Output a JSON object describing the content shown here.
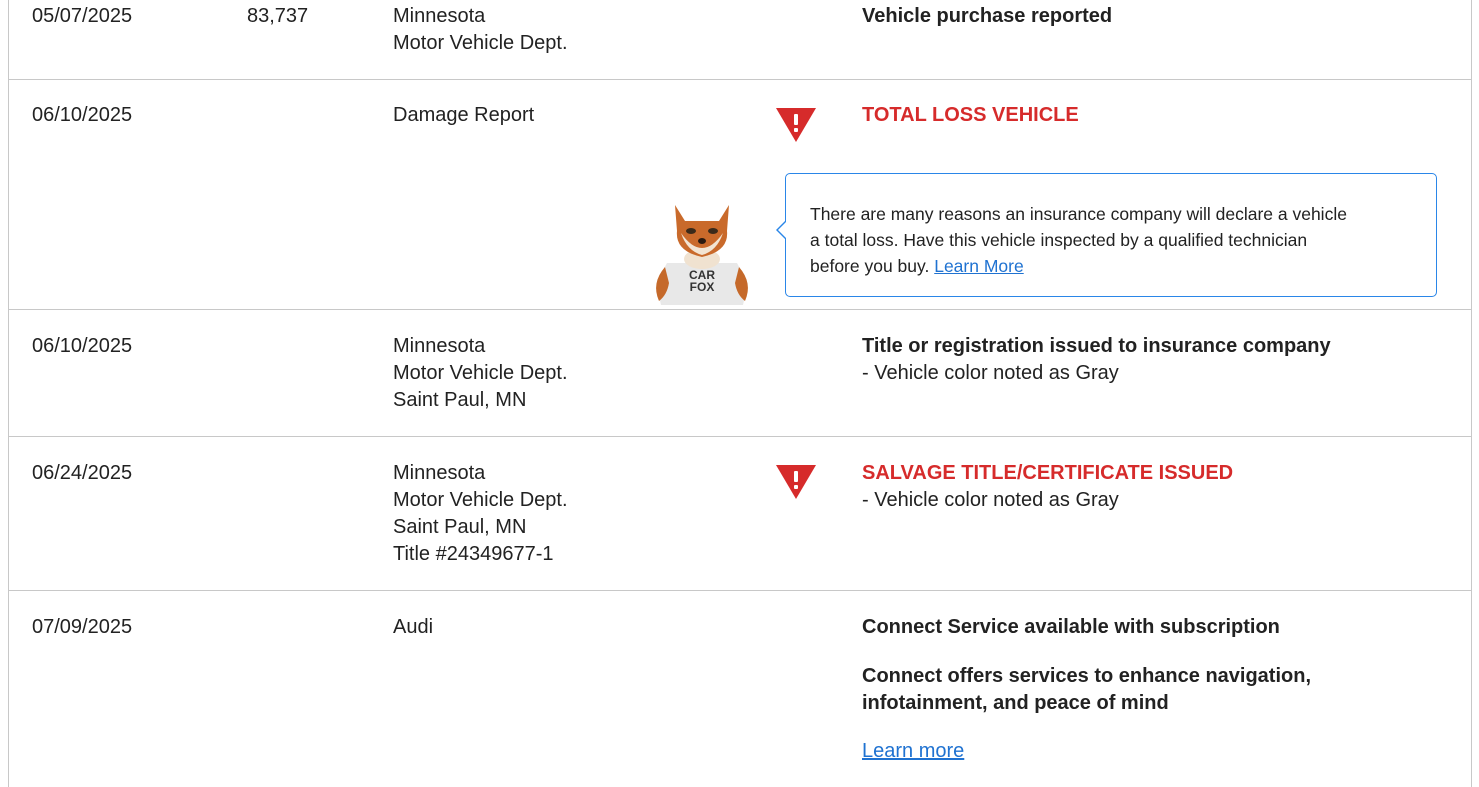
{
  "rows": [
    {
      "date": "05/07/2025",
      "mileage": "83,737",
      "source": [
        "Minnesota",
        "Motor Vehicle Dept."
      ],
      "comment_title": "Vehicle purchase reported"
    },
    {
      "date": "06/10/2025",
      "mileage": "",
      "source": [
        "Damage Report"
      ],
      "alert_title": "TOTAL LOSS VEHICLE",
      "tooltip": {
        "text": "There are many reasons an insurance company will declare a vehicle a total loss. Have this vehicle inspected by a qualified technician before you buy.",
        "line1": "There are many reasons an insurance company will declare a vehicle",
        "line2": "a total loss. Have this vehicle inspected by a qualified technician",
        "line3": "before you buy.",
        "link": "Learn More"
      },
      "mascot_text": [
        "CAR",
        "FOX"
      ]
    },
    {
      "date": "06/10/2025",
      "mileage": "",
      "source": [
        "Minnesota",
        "Motor Vehicle Dept.",
        "Saint Paul, MN"
      ],
      "comment_title": "Title or registration issued to insurance company",
      "comment_detail": "- Vehicle color noted as Gray"
    },
    {
      "date": "06/24/2025",
      "mileage": "",
      "source": [
        "Minnesota",
        "Motor Vehicle Dept.",
        "Saint Paul, MN",
        "Title #24349677-1"
      ],
      "alert_title": "SALVAGE TITLE/CERTIFICATE ISSUED",
      "comment_detail": "- Vehicle color noted as Gray"
    },
    {
      "date": "07/09/2025",
      "mileage": "",
      "source": [
        "Audi"
      ],
      "comment_title": "Connect Service available with subscription",
      "comment_body": [
        "Connect offers services to enhance navigation,",
        "infotainment, and peace of mind"
      ],
      "link": "Learn more"
    }
  ],
  "icons": {
    "warning": "warning-triangle-icon",
    "mascot": "carfox-mascot-icon"
  },
  "colors": {
    "alert": "#d62b2b",
    "link": "#1f72d1",
    "tooltip_border": "#2a86e8",
    "divider": "#c8c8c8"
  }
}
